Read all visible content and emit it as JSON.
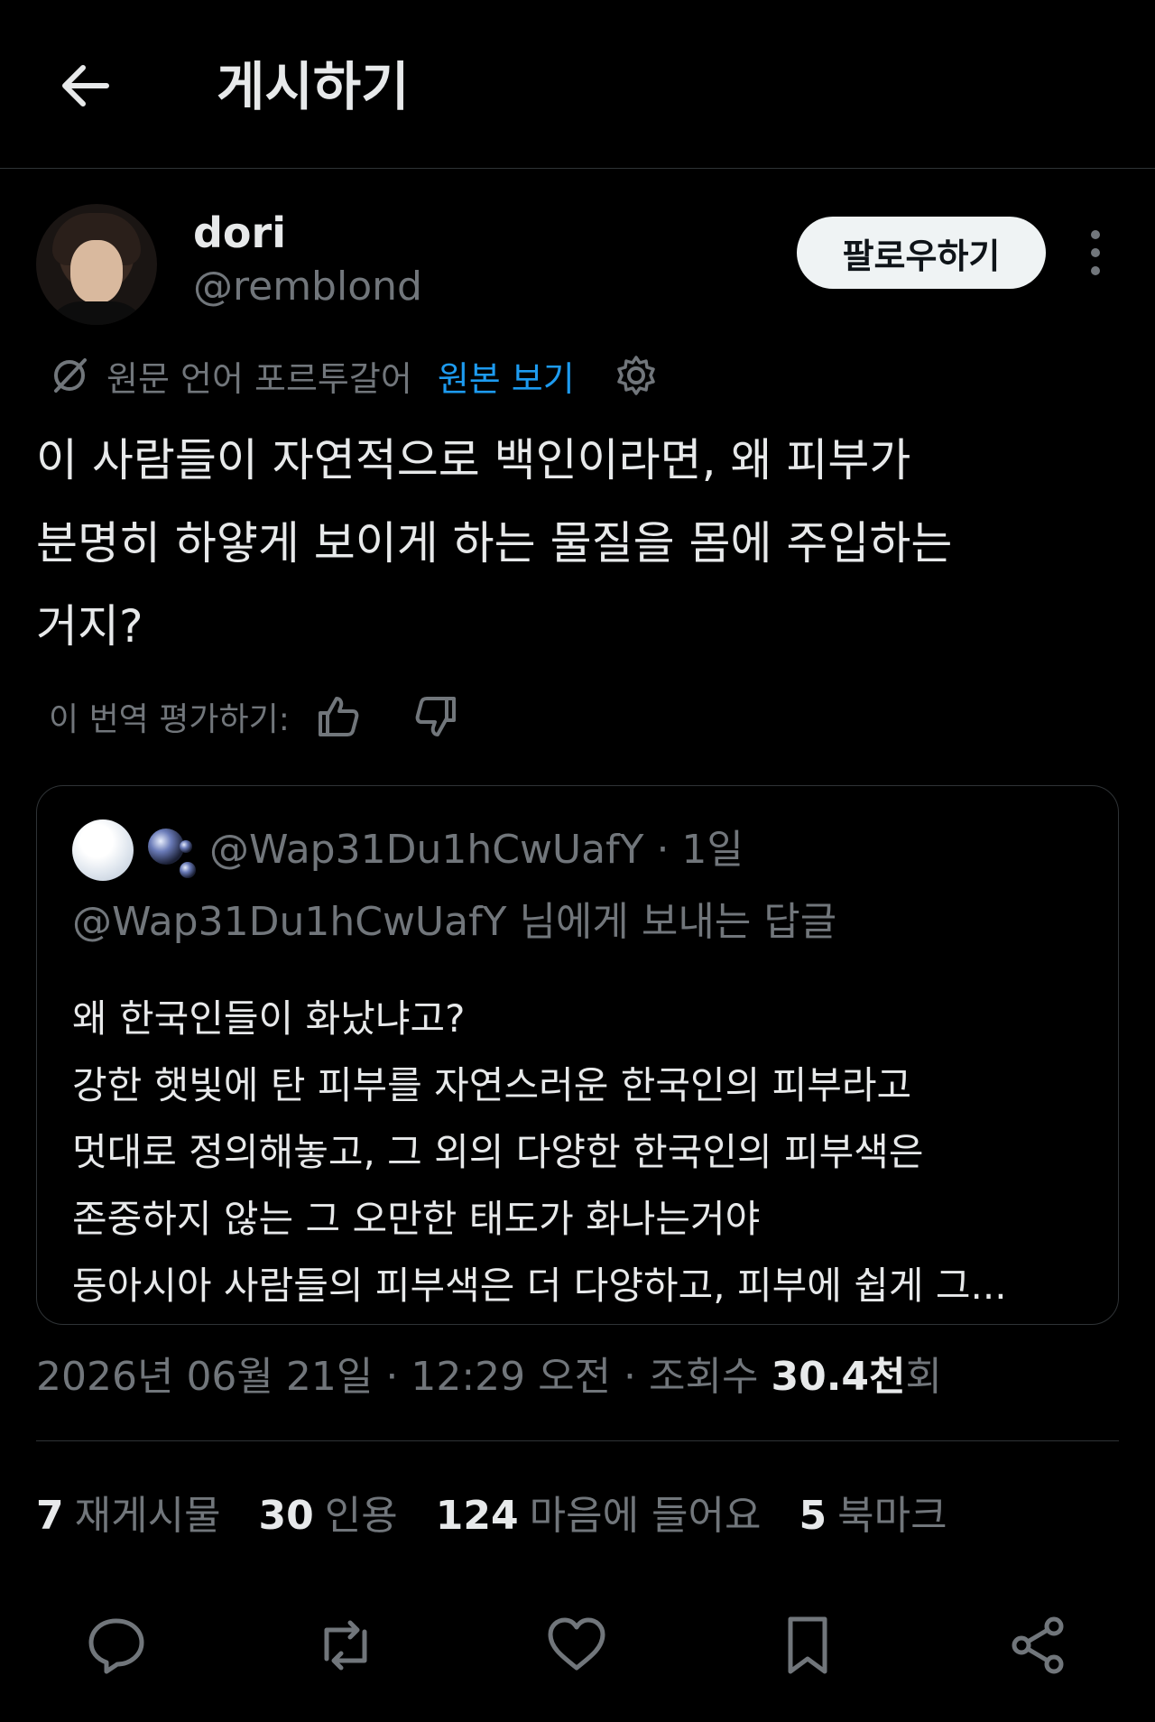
{
  "header": {
    "title": "게시하기",
    "back_icon": "back-arrow-icon"
  },
  "author": {
    "display_name": "dori",
    "handle": "@remblond",
    "follow_label": "팔로우하기",
    "more_icon": "more-vertical-icon"
  },
  "translation": {
    "icon": "translate-icon",
    "language_label": "원문 언어 포르투갈어",
    "view_original_label": "원본 보기",
    "settings_icon": "gear-icon"
  },
  "tweet": {
    "text": "이 사람들이 자연적으로 백인이라면, 왜 피부가\n분명히 하얗게 보이게 하는 물질을 몸에 주입하는\n거지?"
  },
  "rate_translation": {
    "label": "이 번역 평가하기:",
    "up_icon": "thumbs-up-icon",
    "down_icon": "thumbs-down-icon"
  },
  "quoted_tweet": {
    "handle_line": "@Wap31Du1hCwUafY · 1일",
    "reply_to": "@Wap31Du1hCwUafY 님에게 보내는 답글",
    "text": "왜 한국인들이 화났냐고?\n강한 햇빛에 탄 피부를 자연스러운 한국인의 피부라고\n멋대로 정의해놓고, 그 외의 다양한 한국인의 피부색은\n존중하지 않는 그 오만한 태도가 화나는거야\n동아시아 사람들의 피부색은 더 다양하고, 피부에 쉽게 그..."
  },
  "meta": {
    "timestamp": "2026년 06월 21일 · 12:29 오전 · 조회수 ",
    "views_number": "30.4천",
    "views_suffix": "회"
  },
  "stats": [
    {
      "num": "7",
      "label": "재게시물"
    },
    {
      "num": "30",
      "label": "인용"
    },
    {
      "num": "124",
      "label": "마음에 들어요"
    },
    {
      "num": "5",
      "label": "북마크"
    }
  ],
  "actions": [
    "reply-icon",
    "repost-icon",
    "like-icon",
    "bookmark-icon",
    "share-icon"
  ],
  "colors": {
    "background": "#000000",
    "text": "#e7e9ea",
    "muted": "#71767b",
    "link": "#1d9bf0",
    "border": "#2f3336"
  }
}
